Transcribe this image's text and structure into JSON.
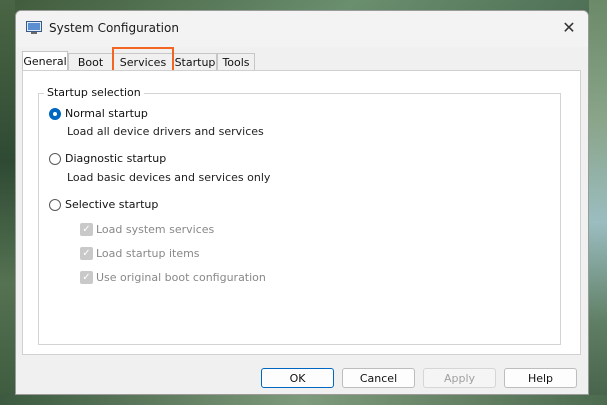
{
  "window": {
    "title": "System Configuration",
    "close_glyph": "✕"
  },
  "tabs": [
    {
      "label": "General",
      "active": true
    },
    {
      "label": "Boot",
      "active": false
    },
    {
      "label": "Services",
      "active": false,
      "highlighted": true
    },
    {
      "label": "Startup",
      "active": false
    },
    {
      "label": "Tools",
      "active": false
    }
  ],
  "startup": {
    "group_label": "Startup selection",
    "options": [
      {
        "label": "Normal startup",
        "description": "Load all device drivers and services",
        "selected": true
      },
      {
        "label": "Diagnostic startup",
        "description": "Load basic devices and services only",
        "selected": false
      },
      {
        "label": "Selective startup",
        "selected": false
      }
    ],
    "selective_items": [
      {
        "label": "Load system services",
        "checked": true,
        "enabled": false
      },
      {
        "label": "Load startup items",
        "checked": true,
        "enabled": false
      },
      {
        "label": "Use original boot configuration",
        "checked": true,
        "enabled": false
      }
    ]
  },
  "buttons": {
    "ok": "OK",
    "cancel": "Cancel",
    "apply": "Apply",
    "help": "Help"
  },
  "colors": {
    "accent": "#0067c0",
    "highlight": "#f26522"
  },
  "icons": {
    "app": "system-config-icon",
    "close": "close-icon",
    "radio": "radio-icon",
    "check": "check-icon"
  }
}
